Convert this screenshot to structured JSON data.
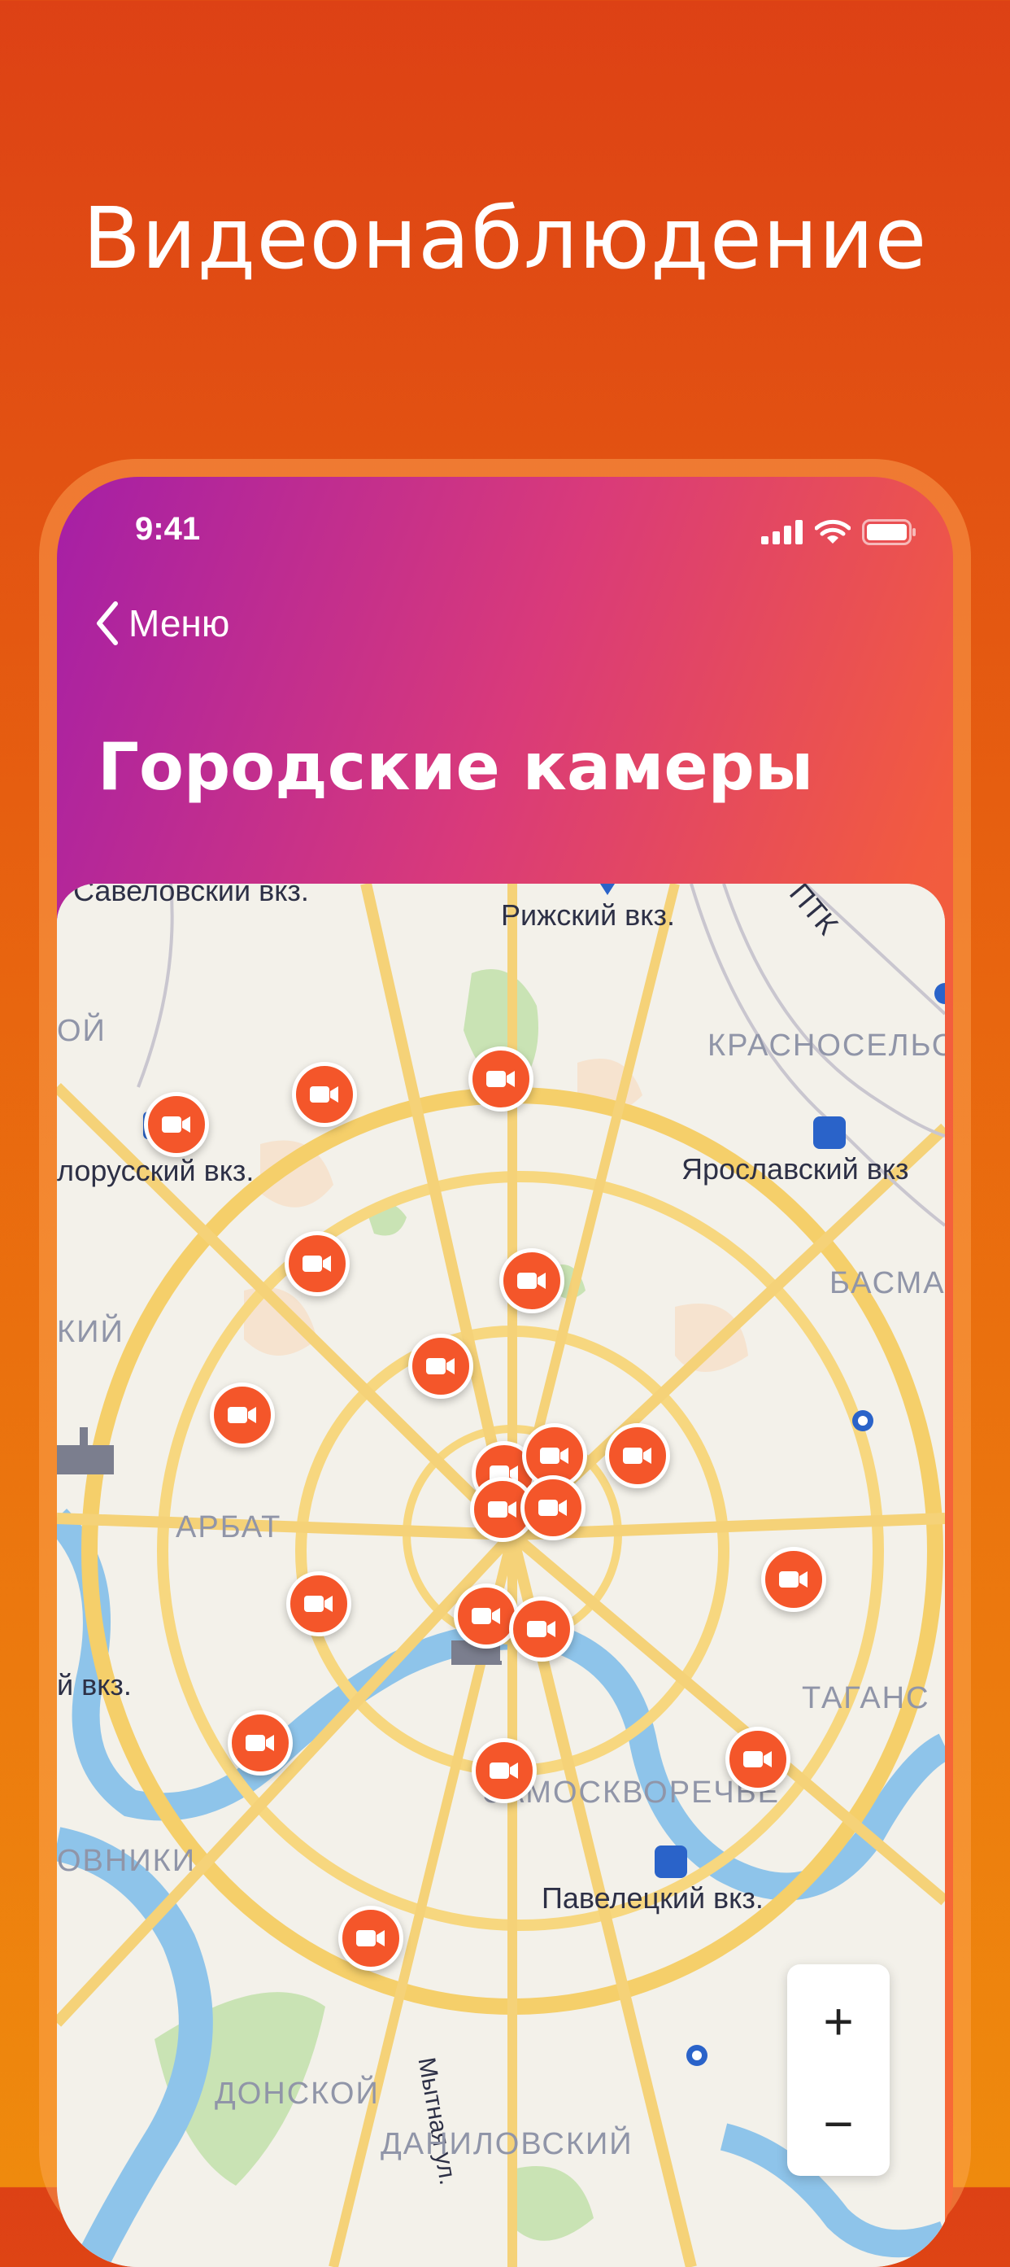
{
  "promo": {
    "title": "Видеонаблюдение"
  },
  "status_bar": {
    "time": "9:41",
    "icons": [
      "signal-icon",
      "wifi-icon",
      "battery-icon"
    ]
  },
  "nav": {
    "back_label": "Меню",
    "back_icon": "chevron-left-icon",
    "title": "Городские камеры"
  },
  "colors": {
    "accent": "#f4562a",
    "gradient_start": "#a51fa6",
    "gradient_end": "#f86b35",
    "background_top": "#dd4115",
    "background_bottom": "#ef8a0d"
  },
  "map": {
    "labels": {
      "savelovsky": "Савеловский вкз.",
      "rizhsky": "Рижский вкз.",
      "ptk": "ПТК",
      "oi": "ОЙ",
      "krasnoselsky": "КРАСНОСЕЛЬС",
      "belorussky": "лорусский вкз.",
      "yaroslavsky": "Ярославский вкз",
      "basman": "БАСМА",
      "kiy": "КИЙ",
      "arbat": "АРБАТ",
      "kievsky": "й вкз.",
      "tagansky": "ТАГАНС",
      "zamoskvorechye": "ЗАМОСКВОРЕЧЬЕ",
      "ovniki": "ОВНИКИ",
      "paveletsky": "Павелецкий вкз.",
      "mytnaya": "Мытная ул.",
      "donskoy": "ДОНСКОЙ",
      "danilovsky": "ДАНИЛОВСКИЙ"
    },
    "camera_icon": "video-camera-icon",
    "camera_count": 20,
    "zoom": {
      "plus": "+",
      "minus": "−"
    }
  }
}
